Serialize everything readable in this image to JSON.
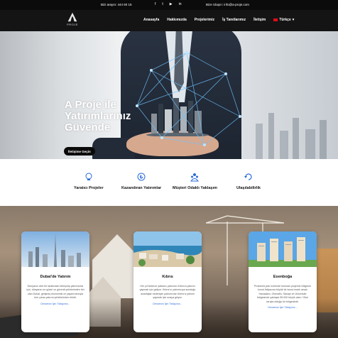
{
  "topbar": {
    "phone": "Bizi arayın: 444 60 15",
    "email": "Bize Ulaşın: info@a-proje.com",
    "social": [
      {
        "name": "facebook",
        "glyph": "f"
      },
      {
        "name": "twitter",
        "glyph": "t"
      },
      {
        "name": "youtube",
        "glyph": "▶"
      },
      {
        "name": "linkedin",
        "glyph": "in"
      }
    ]
  },
  "logo": {
    "text": "PROJE"
  },
  "nav": {
    "items": [
      "Anasayfa",
      "Hakkımızda",
      "Projelerimiz",
      "İş Tanıtlarımız",
      "İletişim"
    ],
    "language": "Türkçe"
  },
  "hero": {
    "title": "A Proje ile Yatırımlarınız Güvende",
    "cta": "İletişime Geçin"
  },
  "features": [
    {
      "label": "Yaratıcı Projeler",
      "icon": "lightbulb-icon"
    },
    {
      "label": "Kazandıran Yatırımlar",
      "icon": "money-icon"
    },
    {
      "label": "Müşteri Odaklı Yaklaşım",
      "icon": "users-icon"
    },
    {
      "label": "Ulaşılabilirlik",
      "icon": "refresh-icon"
    }
  ],
  "cards": [
    {
      "title": "Dubai'de Yatırım",
      "text": "Dünyanın dört bir tarafından birleşmiş yatırımcılar için, dünyanın en güzel ve güvenli şehirlerinden biri olan Dubai, gelişmiş ekonomisi ve yaşam tarzıyla öne çıkan yatırım şehirlerinden biridir.",
      "more": "Devamını İçin Tıklayınız..."
    },
    {
      "title": "Kıbrıs",
      "text": "Her yıl binlerce yabancı yatırımcı Kıbrıs'a yatırım yapmak için geliyor. Kıbrıs'ın yatırımcıya sunduğu avantajlar nedeniyle yatırımcılar Kıbrıs'a yatırım yapmak için sıraya giriyor.",
      "more": "Devamını İçin Tıklayınız..."
    },
    {
      "title": "Esenboğa",
      "text": "Proksimit yolu üzerinde bulunan projemiz bölgenin konut ihtiyacına büyük bir konut imarlı arsalı Havaalanı, Otomotiv, Sanayi ve Üniversite bölgesinde yaklaşık 95.000 büyük alan / Okul tarıyla olduğu bir bölgededir.",
      "more": "Devamını İçin Tıklayınız..."
    }
  ],
  "colors": {
    "topbar": "#0b0b0b",
    "nav": "#141414",
    "accent": "#2b6cd9",
    "flag": "#e30a17"
  }
}
